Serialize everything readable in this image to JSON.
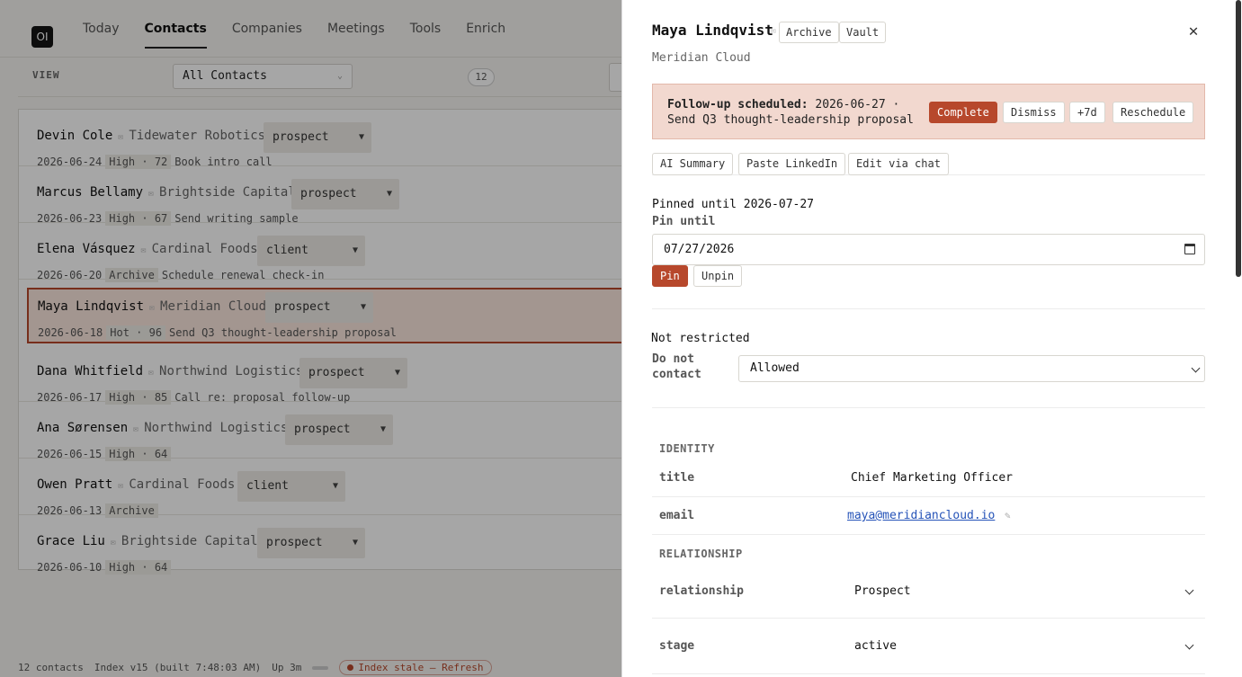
{
  "app": {
    "logo": "OI",
    "nav": [
      "Today",
      "Contacts",
      "Companies",
      "Meetings",
      "Tools",
      "Enrich"
    ],
    "active_nav": "Contacts",
    "view_label": "VIEW",
    "view_select": "All Contacts",
    "view_count": "12"
  },
  "contacts": [
    {
      "name": "Devin Cole",
      "company": "Tidewater Robotics",
      "status": "prospect",
      "date": "2026-06-24",
      "badge": "High · 72",
      "note": "Book intro call"
    },
    {
      "name": "Marcus Bellamy",
      "company": "Brightside Capital",
      "status": "prospect",
      "date": "2026-06-23",
      "badge": "High · 67",
      "note": "Send writing sample"
    },
    {
      "name": "Elena Vásquez",
      "company": "Cardinal Foods",
      "status": "client",
      "date": "2026-06-20",
      "badge": "Archive",
      "note": "Schedule renewal check-in"
    },
    {
      "name": "Maya Lindqvist",
      "company": "Meridian Cloud",
      "status": "prospect",
      "date": "2026-06-18",
      "badge": "Hot · 96",
      "note": "Send Q3 thought-leadership proposal"
    },
    {
      "name": "Dana Whitfield",
      "company": "Northwind Logistics",
      "status": "prospect",
      "date": "2026-06-17",
      "badge": "High · 85",
      "note": "Call re: proposal follow-up"
    },
    {
      "name": "Ana Sørensen",
      "company": "Northwind Logistics",
      "status": "prospect",
      "date": "2026-06-15",
      "badge": "High · 64",
      "note": ""
    },
    {
      "name": "Owen Pratt",
      "company": "Cardinal Foods",
      "status": "client",
      "date": "2026-06-13",
      "badge": "Archive",
      "note": ""
    },
    {
      "name": "Grace Liu",
      "company": "Brightside Capital",
      "status": "prospect",
      "date": "2026-06-10",
      "badge": "High · 64",
      "note": ""
    }
  ],
  "statusbar": {
    "count": "12 contacts",
    "index": "Index v15 (built 7:48:03 AM)",
    "uptime": "Up 3m",
    "stale": "Index stale — Refresh"
  },
  "drawer": {
    "name": "Maya Lindqvist",
    "archive_label": "Archive",
    "vault_label": "Vault",
    "close": "✕",
    "company": "Meridian Cloud",
    "followup": {
      "label": "Follow-up scheduled:",
      "text": "2026-06-27 · Send Q3 thought-leadership proposal",
      "complete": "Complete",
      "dismiss": "Dismiss",
      "plus7": "+7d",
      "reschedule": "Reschedule"
    },
    "tools": {
      "ai_summary": "AI Summary",
      "paste_linkedin": "Paste LinkedIn",
      "edit_chat": "Edit via chat"
    },
    "pin": {
      "status": "Pinned until 2026-07-27",
      "label": "Pin until",
      "value": "07/27/2026",
      "pin": "Pin",
      "unpin": "Unpin"
    },
    "restrict": {
      "status": "Not restricted",
      "label": "Do not contact",
      "value": "Allowed"
    },
    "identity": {
      "heading": "IDENTITY",
      "title_key": "title",
      "title_value": "Chief Marketing Officer",
      "email_key": "email",
      "email_value": "maya@meridiancloud.io"
    },
    "relationship": {
      "heading": "RELATIONSHIP",
      "relationship_key": "relationship",
      "relationship_value": "Prospect",
      "stage_key": "stage",
      "stage_value": "active"
    }
  }
}
